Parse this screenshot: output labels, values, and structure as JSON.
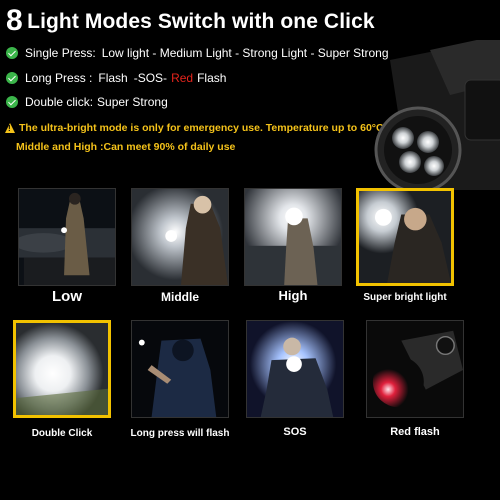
{
  "header": {
    "number": "8",
    "title": "Light Modes Switch with one Click"
  },
  "modes": {
    "single_label": "Single Press:",
    "single_seq": "Low light - Medium Light - Strong Light - Super Strong",
    "long_label": "Long Press :",
    "long_flash": "Flash",
    "long_sos": "-SOS-",
    "long_red": "Red",
    "long_red_rest": "Flash",
    "double_label": "Double click:",
    "double_value": "Super Strong"
  },
  "warning": {
    "line1": "The ultra-bright mode is only for emergency use. Temperature up to 60°C",
    "line2": "Middle  and  High :Can meet 90% of daily use"
  },
  "tiles": [
    {
      "label": "Low"
    },
    {
      "label": "Middle"
    },
    {
      "label": "High"
    },
    {
      "label": "Super bright light"
    },
    {
      "label": "Double Click"
    },
    {
      "label": "Long press will flash"
    },
    {
      "label": "SOS"
    },
    {
      "label": "Red flash"
    }
  ],
  "colors": {
    "check_green": "#3bb54a",
    "warning_yellow": "#f4c21a",
    "highlight_border": "#f2c200",
    "red_text": "#e5241c"
  }
}
